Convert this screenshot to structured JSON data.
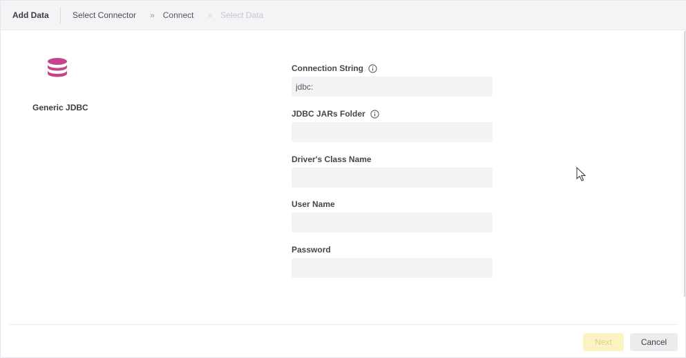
{
  "header": {
    "title": "Add Data",
    "steps": [
      {
        "label": "Select Connector",
        "state": "done"
      },
      {
        "label": "Connect",
        "state": "current"
      },
      {
        "label": "Select Data",
        "state": "disabled"
      }
    ],
    "separator": "»"
  },
  "connector": {
    "name": "Generic JDBC",
    "icon": "database-icon",
    "icon_color": "#c2458d"
  },
  "form": {
    "connection_string": {
      "label": "Connection String",
      "value": "jdbc:",
      "has_info": true
    },
    "jars_folder": {
      "label": "JDBC JARs Folder",
      "value": "",
      "has_info": true
    },
    "driver_class": {
      "label": "Driver's Class Name",
      "value": ""
    },
    "user_name": {
      "label": "User Name",
      "value": ""
    },
    "password": {
      "label": "Password",
      "value": ""
    }
  },
  "footer": {
    "next_label": "Next",
    "next_enabled": false,
    "cancel_label": "Cancel"
  },
  "colors": {
    "accent": "#c2458d",
    "next_disabled_bg": "#fdf2c4",
    "input_bg": "#f3f3f6"
  }
}
